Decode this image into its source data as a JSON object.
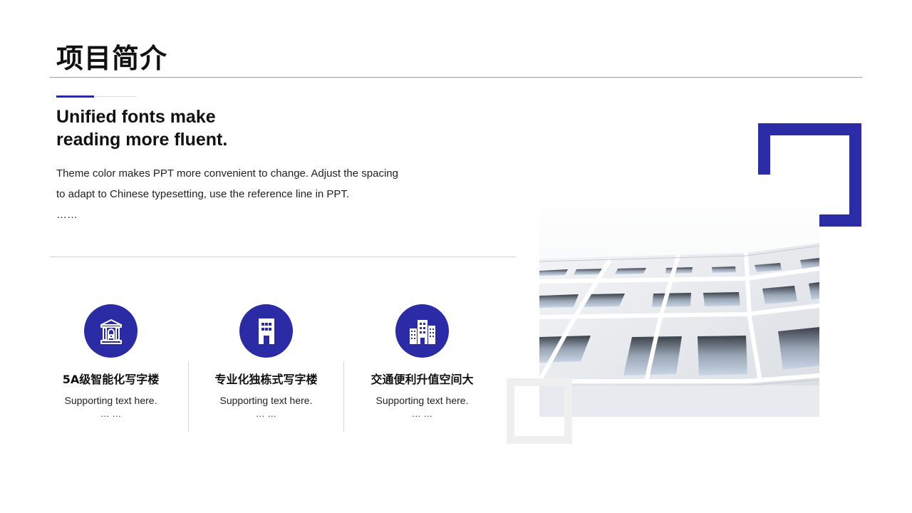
{
  "slide": {
    "title": "项目简介",
    "headline": [
      "Unified fonts make",
      "reading more fluent."
    ],
    "body_lines": [
      "Theme color makes PPT more convenient to change. Adjust the spacing",
      "to adapt to Chinese typesetting, use the reference line in PPT.",
      "……"
    ]
  },
  "features": [
    {
      "icon": "bank-building-icon",
      "title": "5A级智能化写字楼",
      "subtitle": "Supporting  text here.",
      "dots": "… …"
    },
    {
      "icon": "office-tower-icon",
      "title": "专业化独栋式写字楼",
      "subtitle": "Supporting  text here.",
      "dots": "… …"
    },
    {
      "icon": "city-buildings-icon",
      "title": "交通便利升值空间大",
      "subtitle": "Supporting  text here.",
      "dots": "… …"
    }
  ],
  "colors": {
    "accent": "#2b2ba5",
    "text": "#111111",
    "rule": "#9a9a9a",
    "light_frame": "#efefef"
  }
}
